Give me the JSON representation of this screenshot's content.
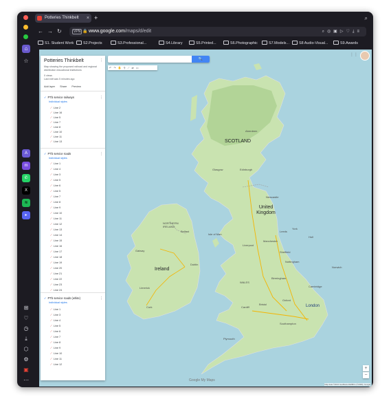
{
  "browser": {
    "tab_title": "Potteries Thinkbelt",
    "url_host": "www.google.com",
    "url_path": "/maps/d/edit",
    "vpn_badge": "VPN",
    "bookmarks": [
      "S1. Student Work",
      "S2.Projects",
      "S3.Professional...",
      "S4.Library",
      "S5.Printed...",
      "S6.Photographic",
      "S7.Models...",
      "S8 Audio-Visual...",
      "S9.Awards"
    ]
  },
  "map_panel": {
    "title": "Potteries Thinkbelt",
    "description": "Map showing the proposed railroad and regional distribution educational institutions",
    "views": "0 views",
    "last_edit": "Last edit was 5 minutes ago",
    "actions": [
      "Add layer",
      "Share",
      "Preview"
    ],
    "layers": [
      {
        "title": "PTb service railways",
        "style": "Individual styles",
        "items": [
          "Line 2",
          "Line 16",
          "Line 5",
          "Line 7",
          "Line 8",
          "Line 10",
          "Line 11",
          "Line 13"
        ]
      },
      {
        "title": "PTb service roads",
        "style": "Individual styles",
        "items": [
          "Line 1",
          "Line 4",
          "Line 3",
          "Line 5",
          "Line 6",
          "Line 5",
          "Line 7",
          "Line 8",
          "Line 9",
          "Line 10",
          "Line 11",
          "Line 12",
          "Line 13",
          "Line 14",
          "Line 15",
          "Line 16",
          "Line 17",
          "Line 18",
          "Line 19",
          "Line 20",
          "Line 21",
          "Line 22",
          "Line 23",
          "Line 24"
        ]
      },
      {
        "title": "PTb service roads (white)",
        "style": "Individual styles",
        "items": [
          "Line 1",
          "Line 3",
          "Line 4",
          "Line 5",
          "Line 6",
          "Line 7",
          "Line 8",
          "Line 9",
          "Line 10",
          "Line 11",
          "Line 12"
        ]
      }
    ]
  },
  "map": {
    "search_button": "🔍",
    "labels": {
      "scotland": "SCOTLAND",
      "glasgow": "Glasgow",
      "edinburgh": "Edinburgh",
      "united_kingdom": "United Kingdom",
      "isle_of_man": "Isle of Man",
      "northern_ireland": "NORTHERN IRELAND",
      "belfast": "Belfast",
      "ireland": "Ireland",
      "dublin": "Dublin",
      "leeds": "Leeds",
      "manchester": "Manchester",
      "liverpool": "Liverpool",
      "birmingham": "Birmingham",
      "london": "London",
      "wales": "WALES",
      "cardiff": "Cardiff",
      "bristol": "Bristol",
      "cambridge": "Cambridge",
      "oxford": "Oxford",
      "newcastle": "Newcastle",
      "aberdeen": "Aberdeen",
      "cork": "Cork",
      "limerick": "Limerick",
      "galway": "Galway",
      "plymouth": "Plymouth",
      "southampton": "Southampton",
      "york": "York",
      "hull": "Hull",
      "sheffield": "Sheffield",
      "nottingham": "Nottingham",
      "norwich": "Norwich"
    },
    "google_logo": "Google My Maps",
    "attribution": "Map data ©2024 GeoBasis-DE/BKG (©2009), Google"
  },
  "colors": {
    "land": "#c9e3b0",
    "highland": "#b7d59a",
    "water": "#aad3df",
    "accent": "#4285f4"
  }
}
